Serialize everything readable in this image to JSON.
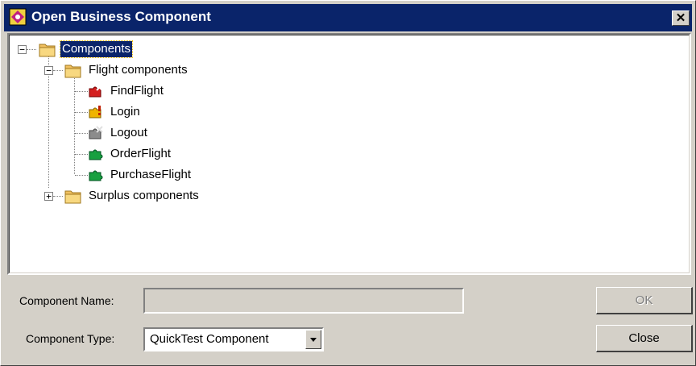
{
  "window": {
    "title": "Open Business Component",
    "close_glyph": "✕"
  },
  "tree": {
    "root": {
      "label": "Components",
      "expanded": true,
      "selected": true
    },
    "folders": [
      {
        "label": "Flight components",
        "expanded": true,
        "items": [
          {
            "label": "FindFlight",
            "icon": "component-error-icon",
            "color": "#d42020"
          },
          {
            "label": "Login",
            "icon": "component-warning-icon",
            "color": "#f0b400"
          },
          {
            "label": "Logout",
            "icon": "component-inactive-icon",
            "color": "#8c8c8c"
          },
          {
            "label": "OrderFlight",
            "icon": "component-ready-icon",
            "color": "#18a040"
          },
          {
            "label": "PurchaseFlight",
            "icon": "component-ready-icon",
            "color": "#18a040"
          }
        ]
      },
      {
        "label": "Surplus components",
        "expanded": false
      }
    ],
    "expand_glyph": "+",
    "collapse_glyph": "−"
  },
  "form": {
    "name_label": "Component Name:",
    "name_value": "",
    "type_label": "Component Type:",
    "type_value": "QuickTest Component"
  },
  "buttons": {
    "ok_label": "OK",
    "close_label": "Close"
  },
  "colors": {
    "titlebar": "#0a246a",
    "face": "#d4d0c8",
    "folder": "#f0c060"
  }
}
